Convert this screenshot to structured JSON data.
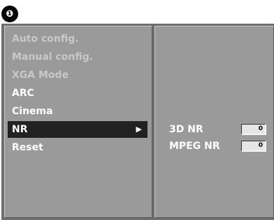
{
  "step_badge": "❶",
  "menu": {
    "items": [
      {
        "label": "Auto config.",
        "state": "disabled"
      },
      {
        "label": "Manual config.",
        "state": "disabled"
      },
      {
        "label": "XGA Mode",
        "state": "disabled"
      },
      {
        "label": "ARC",
        "state": "normal"
      },
      {
        "label": "Cinema",
        "state": "normal"
      },
      {
        "label": "NR",
        "state": "selected",
        "arrow": "▶"
      },
      {
        "label": "Reset",
        "state": "normal"
      }
    ]
  },
  "submenu": {
    "rows": [
      {
        "label": "3D NR",
        "value": "0"
      },
      {
        "label": "MPEG NR",
        "value": "0"
      }
    ]
  },
  "colors": {
    "background_frame": "#6e6e6e",
    "panel": "#9a9a9a",
    "selected": "#222222",
    "text": "#ffffff",
    "disabled_text": "#c8c8c8"
  }
}
